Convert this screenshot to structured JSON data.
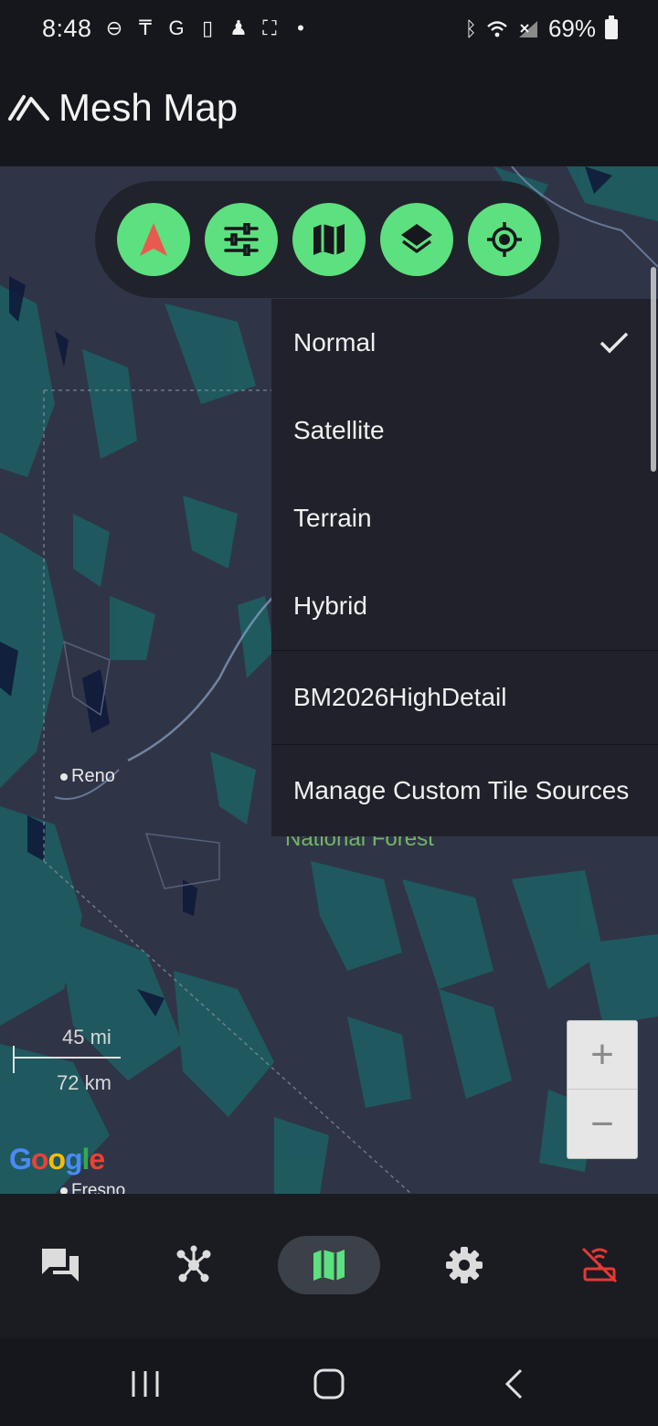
{
  "status_bar": {
    "time": "8:48",
    "battery": "69%",
    "icons": [
      "do-not-disturb-icon",
      "app-icon",
      "google-icon",
      "sim-icon",
      "user-icon",
      "screenshot-icon",
      "dot-icon",
      "bluetooth-icon",
      "wifi-icon",
      "no-signal-icon",
      "battery-icon"
    ]
  },
  "app_bar": {
    "title": "Mesh Map"
  },
  "map": {
    "places": [
      {
        "name": "Reno"
      },
      {
        "name": "Fresno"
      }
    ],
    "park_label": "National Forest",
    "scale": {
      "miles": "45 mi",
      "km": "72 km"
    },
    "attribution": "Google",
    "zoom_in": "+",
    "zoom_out": "−"
  },
  "toolbar": {
    "buttons": [
      "navigation-arrow-icon",
      "tune-icon",
      "map-icon",
      "layers-icon",
      "my-location-icon"
    ]
  },
  "map_type_menu": {
    "items": [
      {
        "label": "Normal",
        "selected": true
      },
      {
        "label": "Satellite",
        "selected": false
      },
      {
        "label": "Terrain",
        "selected": false
      },
      {
        "label": "Hybrid",
        "selected": false
      },
      {
        "label": "BM2026HighDetail",
        "selected": false
      },
      {
        "label": "Manage Custom Tile Sources",
        "selected": false
      }
    ]
  },
  "bottom_nav": {
    "items": [
      "messages-icon",
      "nodes-icon",
      "map-icon",
      "settings-icon",
      "disconnected-icon"
    ],
    "active": "map-icon",
    "colors": {
      "accent": "#5de07f",
      "alert": "#e53935"
    }
  },
  "system_nav": [
    "recent-apps-icon",
    "home-icon",
    "back-icon"
  ]
}
